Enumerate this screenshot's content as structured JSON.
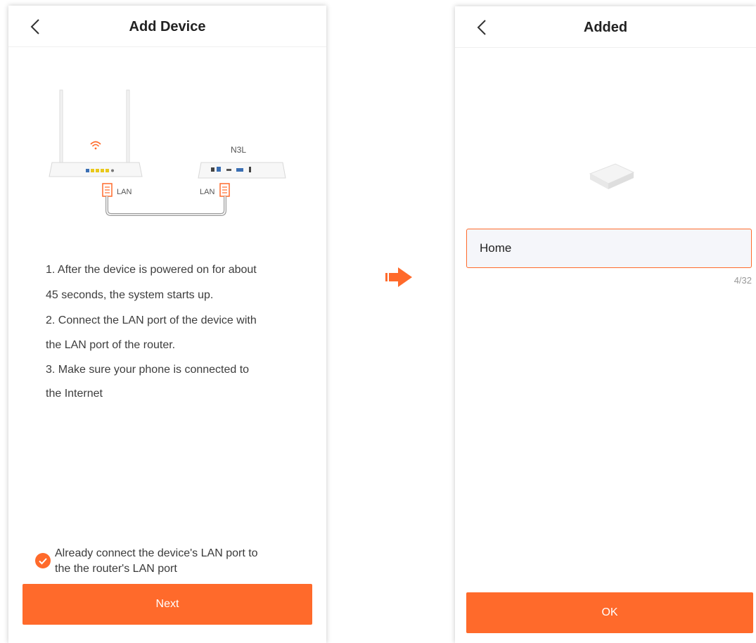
{
  "left_screen": {
    "title": "Add Device",
    "illustration": {
      "device_label": "N3L",
      "router_port_label": "LAN",
      "device_port_label": "LAN"
    },
    "instructions": [
      "1. After the device is powered on for about",
      "45 seconds, the system starts up.",
      "2. Connect the LAN port of the device with",
      "the LAN port of the router.",
      "3. Make sure your phone is connected to",
      "the Internet"
    ],
    "checkbox": {
      "line1": "Already connect the device's LAN port to",
      "line2": "the the router's LAN port",
      "checked": true
    },
    "next_button": "Next"
  },
  "right_screen": {
    "title": "Added",
    "name_input": {
      "value": "Home"
    },
    "char_counter": "4/32",
    "ok_button": "OK"
  },
  "colors": {
    "accent": "#ff6a2b",
    "input_bg": "#f5f6fa"
  },
  "icons": {
    "back": "chevron-left-icon",
    "check": "checkmark-circle-icon",
    "flow_arrow": "arrow-right-icon",
    "wifi": "wifi-icon",
    "ethernet_plug": "ethernet-plug-icon"
  }
}
